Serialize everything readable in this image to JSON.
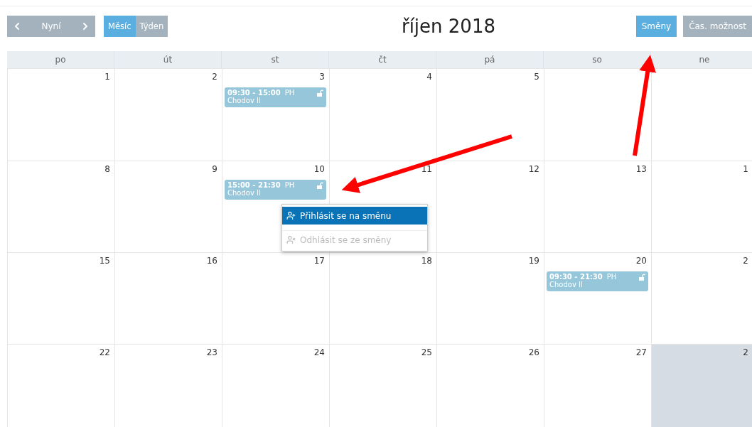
{
  "toolbar": {
    "nav_label": "Nyní",
    "view_tabs": [
      {
        "label": "Měsíc",
        "selected": true
      },
      {
        "label": "Týden",
        "selected": false
      }
    ],
    "title": "říjen 2018",
    "mode_buttons": [
      {
        "label": "Směny",
        "selected": true
      },
      {
        "label": "Čas. možnost",
        "selected": false
      }
    ]
  },
  "weekdays": [
    "po",
    "út",
    "st",
    "čt",
    "pá",
    "so",
    "ne"
  ],
  "weeks": [
    {
      "days": [
        {
          "day": "1",
          "shaded": false
        },
        {
          "day": "2",
          "shaded": false
        },
        {
          "day": "3",
          "shaded": false,
          "events": [
            {
              "time": "09:30 - 15:00",
              "tag": "PH",
              "place": "Chodov II"
            }
          ]
        },
        {
          "day": "4",
          "shaded": false
        },
        {
          "day": "5",
          "shaded": false
        },
        {
          "shaded": false
        },
        {
          "shaded": false
        }
      ]
    },
    {
      "days": [
        {
          "day": "8",
          "shaded": false
        },
        {
          "day": "9",
          "shaded": false
        },
        {
          "day": "10",
          "shaded": false,
          "events": [
            {
              "time": "15:00 - 21:30",
              "tag": "PH",
              "place": "Chodov II"
            }
          ],
          "menu": [
            {
              "label": "Přihlásit se na směnu",
              "kind": "sign-in",
              "selected": true,
              "disabled": false
            },
            {
              "label": "Odhlásit se ze směny",
              "kind": "sign-out",
              "selected": false,
              "disabled": true
            }
          ]
        },
        {
          "day": "11",
          "shaded": false
        },
        {
          "day": "12",
          "shaded": false
        },
        {
          "day": "13",
          "shaded": false
        },
        {
          "day": "1",
          "shaded": false
        }
      ]
    },
    {
      "days": [
        {
          "day": "15",
          "shaded": false
        },
        {
          "day": "16",
          "shaded": false
        },
        {
          "day": "17",
          "shaded": false
        },
        {
          "day": "18",
          "shaded": false
        },
        {
          "day": "19",
          "shaded": false
        },
        {
          "day": "20",
          "shaded": false,
          "events": [
            {
              "time": "09:30 - 21:30",
              "tag": "PH",
              "place": "Chodov II"
            }
          ]
        },
        {
          "day": "2",
          "shaded": false
        }
      ]
    },
    {
      "days": [
        {
          "day": "22",
          "shaded": false
        },
        {
          "day": "23",
          "shaded": false
        },
        {
          "day": "24",
          "shaded": false
        },
        {
          "day": "25",
          "shaded": false
        },
        {
          "day": "26",
          "shaded": false
        },
        {
          "day": "27",
          "shaded": false
        },
        {
          "day": "2",
          "shaded": true
        }
      ]
    }
  ]
}
